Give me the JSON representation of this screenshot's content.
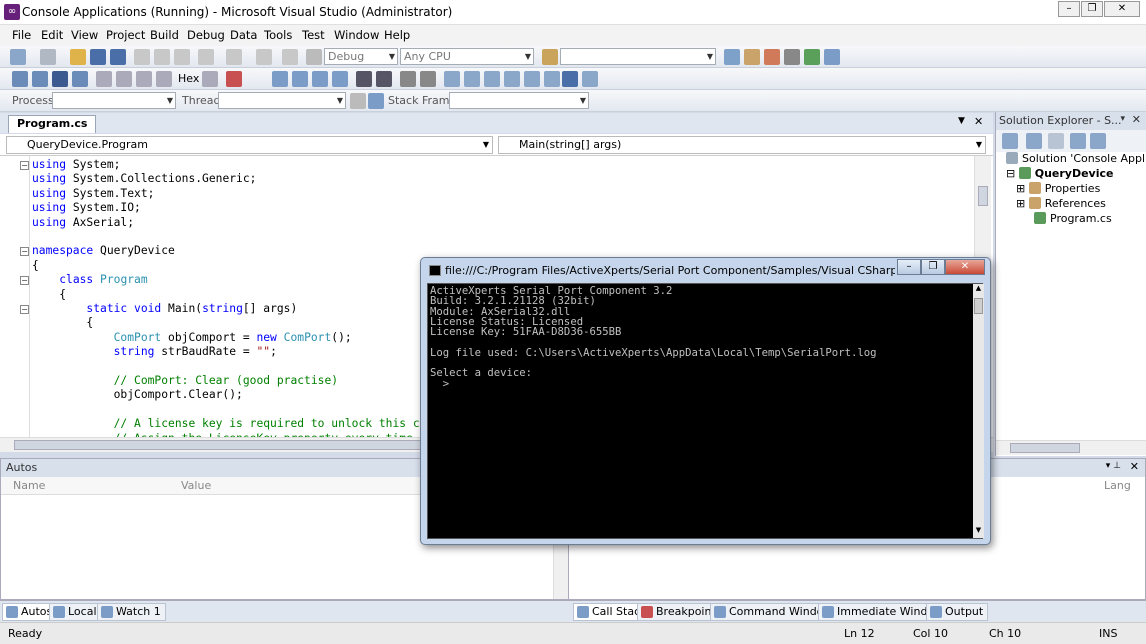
{
  "window": {
    "title": "Console Applications (Running) - Microsoft Visual Studio (Administrator)"
  },
  "menu": [
    "File",
    "Edit",
    "View",
    "Project",
    "Build",
    "Debug",
    "Data",
    "Tools",
    "Test",
    "Window",
    "Help"
  ],
  "toolbar1": {
    "config": "Debug",
    "platform": "Any CPU"
  },
  "toolbar2": {
    "hex": "Hex"
  },
  "toolbar3": {
    "process_label": "Process:",
    "thread_label": "Thread:",
    "stack_label": "Stack Frame:"
  },
  "editor": {
    "tab": "Program.cs",
    "nav_class": "QueryDevice.Program",
    "nav_member": "Main(string[] args)",
    "lines": [
      [
        [
          "kw",
          "using"
        ],
        [
          "t",
          " System;"
        ]
      ],
      [
        [
          "kw",
          "using"
        ],
        [
          "t",
          " System.Collections.Generic;"
        ]
      ],
      [
        [
          "kw",
          "using"
        ],
        [
          "t",
          " System.Text;"
        ]
      ],
      [
        [
          "kw",
          "using"
        ],
        [
          "t",
          " System.IO;"
        ]
      ],
      [
        [
          "kw",
          "using"
        ],
        [
          "t",
          " AxSerial;"
        ]
      ],
      [],
      [
        [
          "kw",
          "namespace"
        ],
        [
          "t",
          " QueryDevice"
        ]
      ],
      [
        [
          "t",
          "{"
        ]
      ],
      [
        [
          "t",
          "    "
        ],
        [
          "kw",
          "class"
        ],
        [
          "t",
          " "
        ],
        [
          "ty",
          "Program"
        ]
      ],
      [
        [
          "t",
          "    {"
        ]
      ],
      [
        [
          "t",
          "        "
        ],
        [
          "kw",
          "static void"
        ],
        [
          "t",
          " Main("
        ],
        [
          "kw",
          "string"
        ],
        [
          "t",
          "[] args)"
        ]
      ],
      [
        [
          "t",
          "        {"
        ]
      ],
      [
        [
          "t",
          "            "
        ],
        [
          "ty",
          "ComPort"
        ],
        [
          "t",
          " objComport = "
        ],
        [
          "kw",
          "new"
        ],
        [
          "t",
          " "
        ],
        [
          "ty",
          "ComPort"
        ],
        [
          "t",
          "();"
        ]
      ],
      [
        [
          "t",
          "            "
        ],
        [
          "kw",
          "string"
        ],
        [
          "t",
          " strBaudRate = "
        ],
        [
          "str",
          "\"\""
        ],
        [
          "t",
          ";"
        ]
      ],
      [],
      [
        [
          "t",
          "            "
        ],
        [
          "cm",
          "// ComPort: Clear (good practise)"
        ]
      ],
      [
        [
          "t",
          "            objComport.Clear();"
        ]
      ],
      [],
      [
        [
          "t",
          "            "
        ],
        [
          "cm",
          "// A license key is required to unlock this c"
        ]
      ],
      [
        [
          "t",
          "            "
        ],
        [
          "cm",
          "// Assign the LicenseKey property every time"
        ]
      ]
    ]
  },
  "solution_explorer": {
    "title": "Solution Explorer - S...",
    "items": [
      {
        "label": "Solution 'Console Applicat",
        "bold": false
      },
      {
        "label": "QueryDevice",
        "bold": true
      },
      {
        "label": "Properties",
        "bold": false
      },
      {
        "label": "References",
        "bold": false
      },
      {
        "label": "Program.cs",
        "bold": false
      }
    ]
  },
  "autos": {
    "title": "Autos",
    "col_name": "Name",
    "col_value": "Value"
  },
  "callstack": {
    "col_lang": "Lang"
  },
  "bottom_tabs_left": [
    "Autos",
    "Locals",
    "Watch 1"
  ],
  "bottom_tabs_right": [
    "Call Stack",
    "Breakpoints",
    "Command Window",
    "Immediate Window",
    "Output"
  ],
  "status": {
    "ready": "Ready",
    "ln": "Ln 12",
    "col": "Col 10",
    "ch": "Ch 10",
    "ins": "INS"
  },
  "console": {
    "title": "file:///C:/Program Files/ActiveXperts/Serial Port Component/Samples/Visual CSharp.NET/Console ...",
    "output": "ActiveXperts Serial Port Component 3.2\nBuild: 3.2.1.21128 (32bit)\nModule: AxSerial32.dll\nLicense Status: Licensed\nLicense Key: 51FAA-D8D36-655BB\n\nLog file used: C:\\Users\\ActiveXperts\\AppData\\Local\\Temp\\SerialPort.log\n\nSelect a device:\n  >"
  }
}
